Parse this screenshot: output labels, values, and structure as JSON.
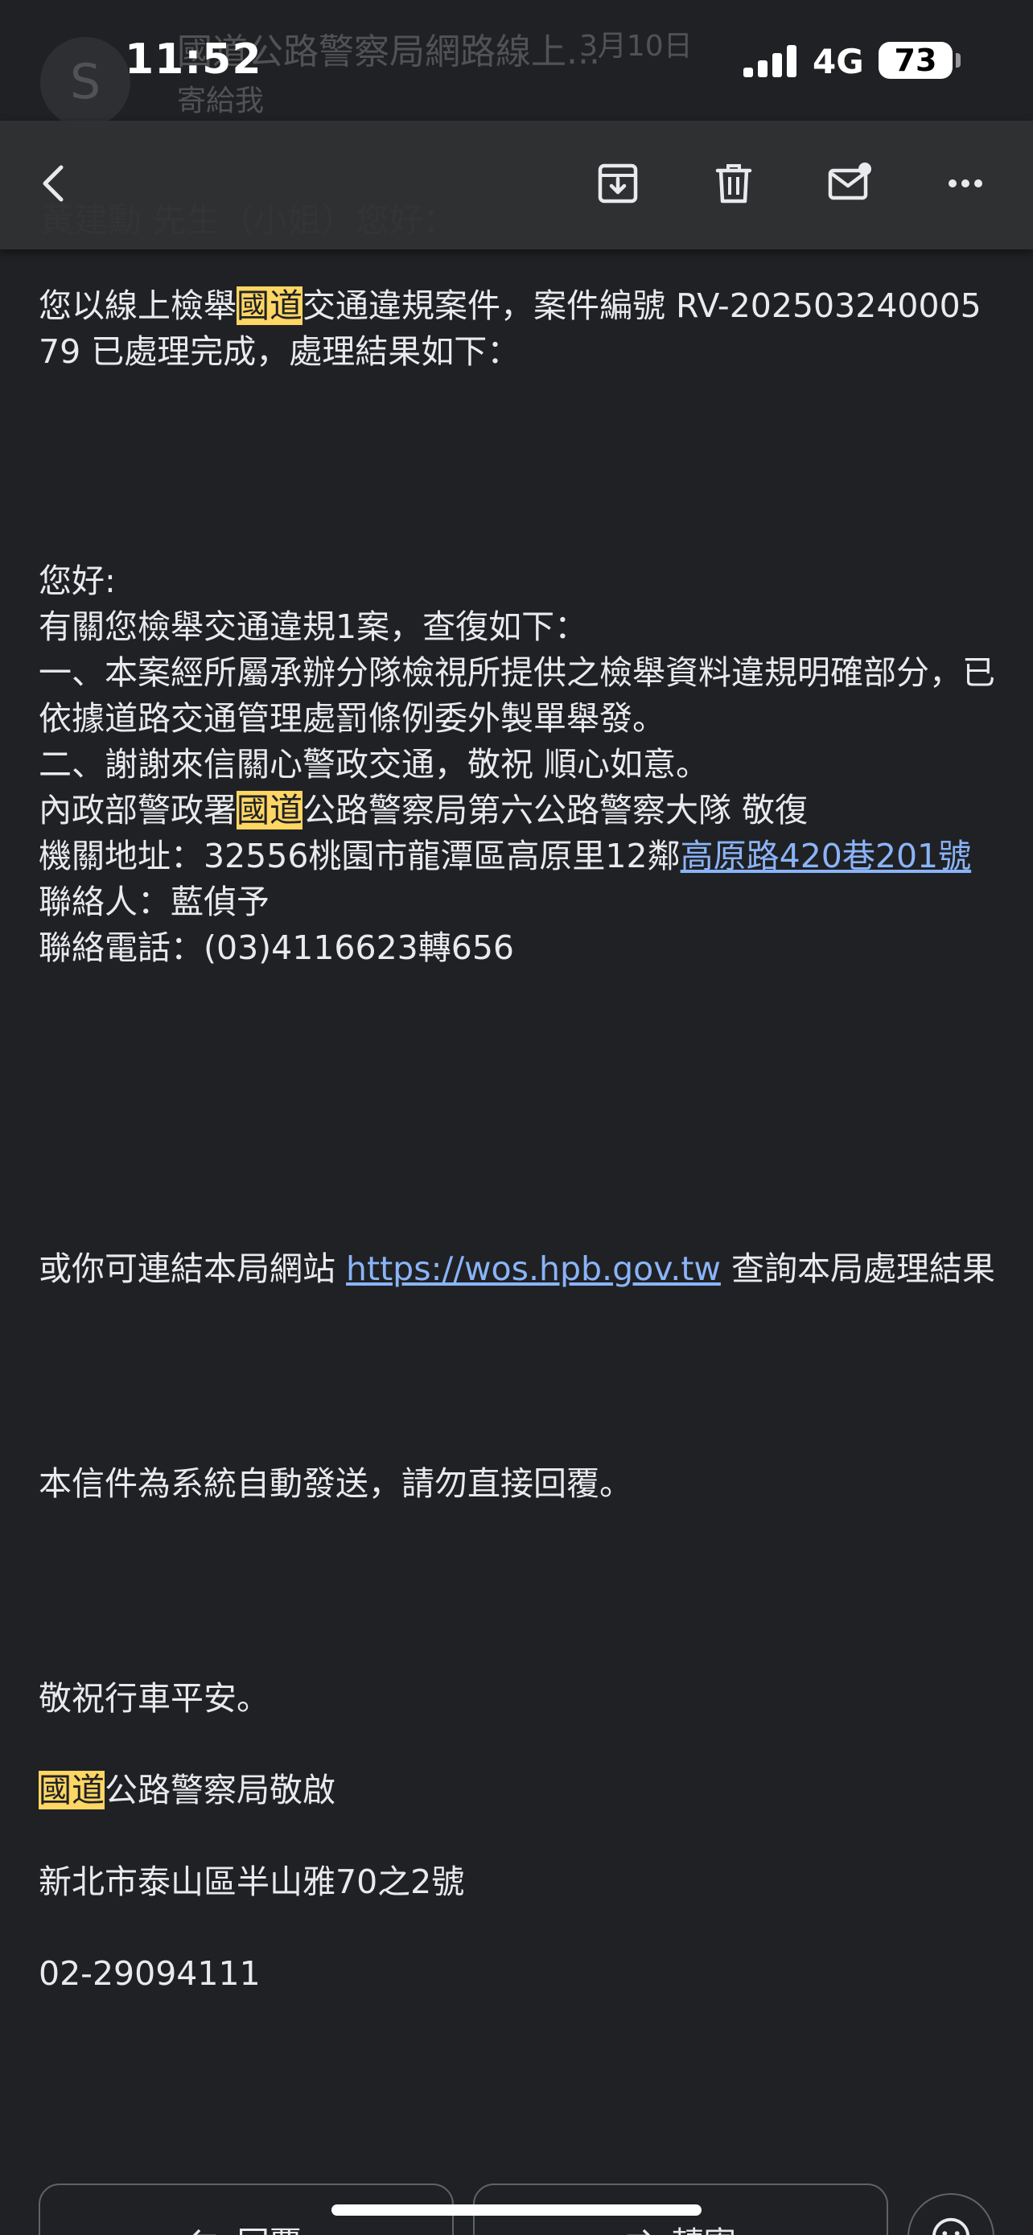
{
  "ghost_header": {
    "avatar_letter": "S",
    "sender": "國道公路警察局網路線上...",
    "date": "3月10日",
    "to": "寄給我",
    "greeting": "黃建勳 先生（小姐）您好："
  },
  "status_bar": {
    "time": "11:52",
    "network": "4G",
    "battery": "73"
  },
  "toolbar": {
    "icons": [
      "back-icon",
      "archive-icon",
      "trash-icon",
      "mark-unread-icon",
      "more-icon"
    ]
  },
  "email": {
    "intro_prefix": "您以線上檢舉",
    "hl": "國道",
    "intro_suffix": "交通違規案件，案件編號 RV-20250324000579 已處理完成，處理結果如下：",
    "greeting2": "您好:",
    "line1": "有關您檢舉交通違規1案，查復如下：",
    "line2": "一、本案經所屬承辦分隊檢視所提供之檢舉資料違規明確部分，已依據道路交通管理處罰條例委外製單舉發。",
    "line3": "二、謝謝來信關心警政交通，敬祝 順心如意。",
    "line4_prefix": "內政部警政署",
    "line4_suffix": "公路警察局第六公路警察大隊 敬復",
    "address_prefix": "機關地址：32556桃園市龍潭區高原里12鄰",
    "address_link": "高原路420巷201號",
    "contact": "聯絡人：藍偵予",
    "phone": "聯絡電話：(03)4116623轉656",
    "website_prefix": "或你可連結本局網站 ",
    "website_link": "https://wos.hpb.gov.tw",
    "website_suffix": " 查詢本局處理結果",
    "auto_notice": "本信件為系統自動發送，請勿直接回覆。",
    "closing": "敬祝行車平安。",
    "sign_suffix": "公路警察局敬啟",
    "sign_address": "新北市泰山區半山雅70之2號",
    "sign_phone": "02-29094111"
  },
  "actions": {
    "reply": "回覆",
    "forward": "轉寄"
  },
  "colors": {
    "background": "#202124",
    "highlight": "#fdd663",
    "link": "#8ab4f8"
  }
}
